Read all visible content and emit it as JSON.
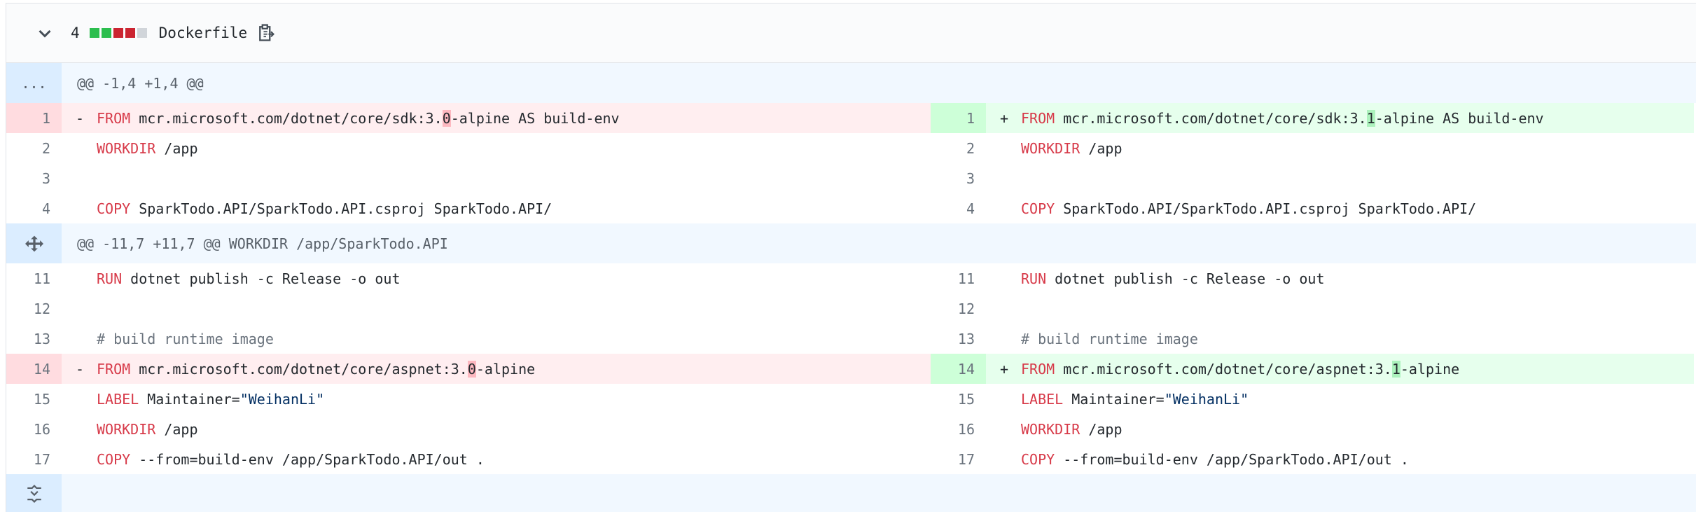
{
  "file": {
    "change_count": "4",
    "name": "Dockerfile",
    "diffstat_colors": [
      "#2cbe4e",
      "#2cbe4e",
      "#cb2431",
      "#cb2431",
      "#d1d5da"
    ]
  },
  "hunks": [
    {
      "expander": "...",
      "header": "@@ -1,4 +1,4 @@"
    },
    {
      "expander": "expand-icon",
      "header": "@@ -11,7 +11,7 @@ WORKDIR /app/SparkTodo.API"
    }
  ],
  "lines": [
    {
      "l_num": "1",
      "r_num": "1",
      "type": "change",
      "l_kw": "FROM",
      "l_pre": " mcr.microsoft.com/dotnet/core/sdk:3.",
      "l_hl": "0",
      "l_post": "-alpine AS build-env",
      "r_kw": "FROM",
      "r_pre": " mcr.microsoft.com/dotnet/core/sdk:3.",
      "r_hl": "1",
      "r_post": "-alpine AS build-env"
    },
    {
      "l_num": "2",
      "r_num": "2",
      "type": "ctx",
      "kw": "WORKDIR",
      "rest": " /app"
    },
    {
      "l_num": "3",
      "r_num": "3",
      "type": "ctx",
      "kw": "",
      "rest": ""
    },
    {
      "l_num": "4",
      "r_num": "4",
      "type": "ctx",
      "kw": "COPY",
      "rest": " SparkTodo.API/SparkTodo.API.csproj SparkTodo.API/"
    },
    {
      "l_num": "11",
      "r_num": "11",
      "type": "ctx",
      "kw": "RUN",
      "rest": " dotnet publish -c Release -o out"
    },
    {
      "l_num": "12",
      "r_num": "12",
      "type": "ctx",
      "kw": "",
      "rest": ""
    },
    {
      "l_num": "13",
      "r_num": "13",
      "type": "comment",
      "text": "# build runtime image"
    },
    {
      "l_num": "14",
      "r_num": "14",
      "type": "change",
      "l_kw": "FROM",
      "l_pre": " mcr.microsoft.com/dotnet/core/aspnet:3.",
      "l_hl": "0",
      "l_post": "-alpine",
      "r_kw": "FROM",
      "r_pre": " mcr.microsoft.com/dotnet/core/aspnet:3.",
      "r_hl": "1",
      "r_post": "-alpine"
    },
    {
      "l_num": "15",
      "r_num": "15",
      "type": "label",
      "kw": "LABEL",
      "rest": " Maintainer=",
      "str": "\"WeihanLi\""
    },
    {
      "l_num": "16",
      "r_num": "16",
      "type": "ctx",
      "kw": "WORKDIR",
      "rest": " /app"
    },
    {
      "l_num": "17",
      "r_num": "17",
      "type": "ctx",
      "kw": "COPY",
      "rest": " --from=build-env /app/SparkTodo.API/out ."
    }
  ],
  "markers": {
    "del": "-",
    "add": "+"
  }
}
